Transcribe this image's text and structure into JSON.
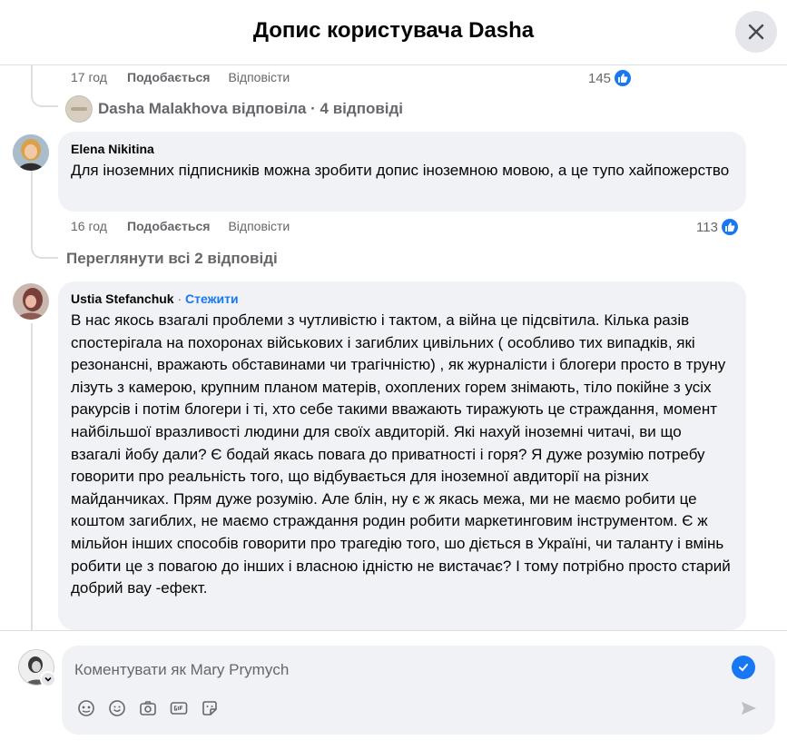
{
  "header": {
    "title": "Допис користувача Dasha",
    "close_icon": "close-icon"
  },
  "comment_top": {
    "time": "17 год",
    "like_label": "Подобається",
    "reply_label": "Відповісти",
    "reaction_count": "145"
  },
  "replies_summary": {
    "text": "Dasha Malakhova відповіла · 4 відповіді"
  },
  "comment_elena": {
    "author": "Elena Nikitina",
    "text": "Для іноземних підписників можна зробити допис іноземною мовою, а це тупо хайпожерство",
    "time": "16 год",
    "like_label": "Подобається",
    "reply_label": "Відповісти",
    "reaction_count": "113"
  },
  "view_replies": {
    "text": "Переглянути всі 2 відповіді"
  },
  "comment_ustia": {
    "author": "Ustia Stefanchuk",
    "separator": " · ",
    "follow_label": "Стежити",
    "text": "В нас якось взагалі проблеми з чутливістю і тактом, а війна це підсвітила. Кілька разів спостерігала на похоронах військових і загиблих цивільних ( особливо тих випадків, які резонансні, вражають обставинами чи трагічністю) , як журналісти і блогери просто в труну лізуть з камерою, крупним планом матерів, охоплених горем знімають, тіло покійне з усіх ракурсів і потім блогери і ті, хто себе такими вважають тиражують це страждання, момент найбільшої вразливості людини для своїх авдиторій. Які нахуй іноземні читачі, ви що взагалі йобу дали? Є бодай якась повага до приватності і горя? Я дуже розумію потребу говорити про реальність того, що відбувається для іноземної авдиторії на різних майданчиках. Прям дуже розумію. Але блін, ну є ж якась межа, ми не маємо робити це коштом загиблих, не маємо страждання родин робити маркетинговим інструментом. Є ж мільйон інших способів говорити про трагедію того, шо діється в Україні, чи таланту і вмінь робити це з повагою до інших і власною ідністю не вистачає? І тому потрібно просто старий добрий вау -ефект."
  },
  "composer": {
    "placeholder": "Коментувати як Mary Prymych",
    "tools": [
      "avatar-sticker-icon",
      "emoji-icon",
      "camera-icon",
      "gif-icon",
      "sticker-icon"
    ],
    "send_icon": "send-icon"
  },
  "colors": {
    "accent": "#1877f2",
    "bubble_bg": "#f0f2f5",
    "secondary_text": "#65676b"
  }
}
